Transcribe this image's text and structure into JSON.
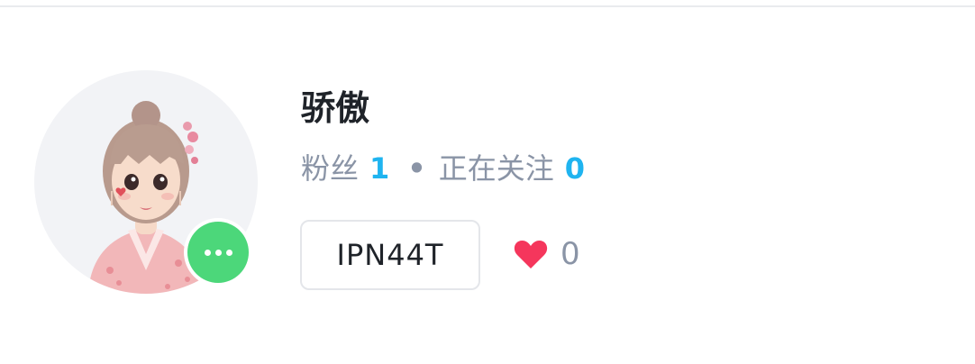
{
  "profile": {
    "username": "骄傲",
    "followers_label": "粉丝",
    "followers_count": "1",
    "separator": "•",
    "following_label": "正在关注",
    "following_count": "0",
    "user_code": "IPN44T",
    "likes_count": "0",
    "avatar_icon": "avatar-image",
    "status_icon": "more-dots-icon",
    "like_icon": "heart-icon"
  },
  "colors": {
    "accent_blue": "#1fb4f0",
    "status_green": "#4cd77a",
    "heart_red": "#f5365c",
    "muted_text": "#8a94a6"
  }
}
